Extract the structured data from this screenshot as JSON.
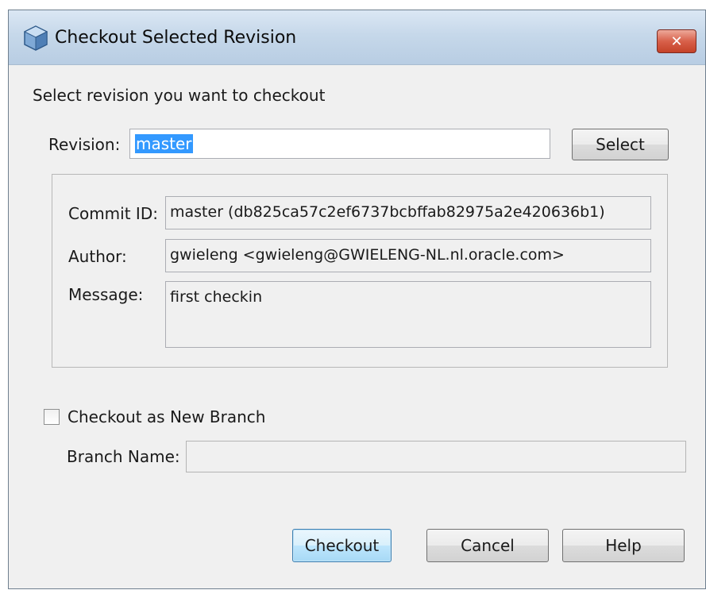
{
  "window": {
    "title": "Checkout Selected Revision",
    "close_label": "✕"
  },
  "instructions": "Select revision you want to checkout",
  "revision": {
    "label": "Revision:",
    "value": "master",
    "select_button": "Select"
  },
  "details": {
    "commit_id_label": "Commit ID:",
    "commit_id_value": "master (db825ca57c2ef6737bcbffab82975a2e420636b1)",
    "author_label": "Author:",
    "author_value": "gwieleng <gwieleng@GWIELENG-NL.nl.oracle.com>",
    "message_label": "Message:",
    "message_value": "first checkin"
  },
  "branch": {
    "checkbox_label": "Checkout as New Branch",
    "checked": false,
    "name_label": "Branch Name:",
    "name_value": ""
  },
  "buttons": {
    "checkout": "Checkout",
    "cancel": "Cancel",
    "help": "Help"
  },
  "colors": {
    "selection": "#3399ff",
    "close_button": "#d8604a",
    "titlebar": "#c6d8ea"
  }
}
